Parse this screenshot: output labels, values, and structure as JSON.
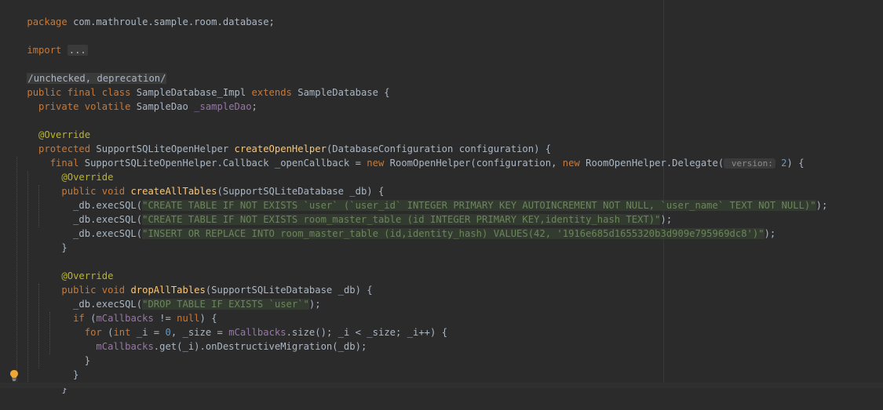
{
  "editor": {
    "lines": [
      {
        "t": "package com.mathroule.sample.room.database;"
      },
      {
        "t": ""
      },
      {
        "t": "import ..."
      },
      {
        "t": ""
      },
      {
        "t": "/unchecked, deprecation/"
      },
      {
        "t": "public final class SampleDatabase_Impl extends SampleDatabase {"
      },
      {
        "t": "  private volatile SampleDao _sampleDao;"
      },
      {
        "t": ""
      },
      {
        "t": "  @Override"
      },
      {
        "t": "  protected SupportSQLiteOpenHelper createOpenHelper(DatabaseConfiguration configuration) {"
      },
      {
        "t": "    final SupportSQLiteOpenHelper.Callback _openCallback = new RoomOpenHelper(configuration, new RoomOpenHelper.Delegate( version: 2) {"
      },
      {
        "t": "      @Override"
      },
      {
        "t": "      public void createAllTables(SupportSQLiteDatabase _db) {"
      },
      {
        "t": "        _db.execSQL(\"CREATE TABLE IF NOT EXISTS `user` (`user_id` INTEGER PRIMARY KEY AUTOINCREMENT NOT NULL, `user_name` TEXT NOT NULL)\");"
      },
      {
        "t": "        _db.execSQL(\"CREATE TABLE IF NOT EXISTS room_master_table (id INTEGER PRIMARY KEY,identity_hash TEXT)\");"
      },
      {
        "t": "        _db.execSQL(\"INSERT OR REPLACE INTO room_master_table (id,identity_hash) VALUES(42, '1916e685d1655320b3d909e795969dc8')\");"
      },
      {
        "t": "      }"
      },
      {
        "t": ""
      },
      {
        "t": "      @Override"
      },
      {
        "t": "      public void dropAllTables(SupportSQLiteDatabase _db) {"
      },
      {
        "t": "        _db.execSQL(\"DROP TABLE IF EXISTS `user`\");"
      },
      {
        "t": "        if (mCallbacks != null) {"
      },
      {
        "t": "          for (int _i = 0, _size = mCallbacks.size(); _i < _size; _i++) {"
      },
      {
        "t": "            mCallbacks.get(_i).onDestructiveMigration(_db);"
      },
      {
        "t": "          }"
      },
      {
        "t": "        }"
      },
      {
        "t": "      }"
      }
    ],
    "tokens": {
      "l0": [
        "package",
        " com.mathroule.sample.room.database;"
      ],
      "l2": [
        "import",
        " ",
        "..."
      ],
      "l4": [
        "/unchecked, deprecation/"
      ],
      "l5": [
        "public final class",
        " SampleDatabase_Impl ",
        "extends",
        " SampleDatabase {"
      ],
      "l6": [
        "  ",
        "private volatile",
        " SampleDao ",
        "_sampleDao",
        ";"
      ],
      "l8": [
        "  ",
        "@Override"
      ],
      "l9": [
        "  ",
        "protected",
        " SupportSQLiteOpenHelper ",
        "createOpenHelper",
        "(DatabaseConfiguration configuration) {"
      ],
      "l10": [
        "    ",
        "final",
        " SupportSQLiteOpenHelper.Callback _openCallback = ",
        "new",
        " RoomOpenHelper(configuration, ",
        "new",
        " RoomOpenHelper.Delegate(",
        " version:",
        " 2",
        ") {"
      ],
      "l11": [
        "      ",
        "@Override"
      ],
      "l12": [
        "      ",
        "public void",
        " ",
        "createAllTables",
        "(SupportSQLiteDatabase _db) {"
      ],
      "l13": [
        "        _db.execSQL(",
        "\"CREATE TABLE IF NOT EXISTS `user` (`user_id` INTEGER PRIMARY KEY AUTOINCREMENT NOT NULL, `user_name` TEXT NOT NULL)\"",
        ");"
      ],
      "l14": [
        "        _db.execSQL(",
        "\"CREATE TABLE IF NOT EXISTS room_master_table (id INTEGER PRIMARY KEY,identity_hash TEXT)\"",
        ");"
      ],
      "l15": [
        "        _db.execSQL(",
        "\"INSERT OR REPLACE INTO room_master_table (id,identity_hash) VALUES(42, '1916e685d1655320b3d909e795969dc8')\"",
        ");"
      ],
      "l16": [
        "      }"
      ],
      "l18": [
        "      ",
        "@Override"
      ],
      "l19": [
        "      ",
        "public void",
        " ",
        "dropAllTables",
        "(SupportSQLiteDatabase _db) {"
      ],
      "l20": [
        "        _db.execSQL(",
        "\"DROP TABLE IF EXISTS `user`\"",
        ");"
      ],
      "l21": [
        "        ",
        "if",
        " (",
        "mCallbacks",
        " != ",
        "null",
        ") {"
      ],
      "l22": [
        "          ",
        "for",
        " (",
        "int",
        " _i = ",
        "0",
        ", _size = ",
        "mCallbacks",
        ".size(); _i < _size; _i++) {"
      ],
      "l23": [
        "            ",
        "mCallbacks",
        ".get(_i).onDestructiveMigration(_db);"
      ],
      "l24": [
        "          }"
      ],
      "l25": [
        "        }"
      ],
      "l26": [
        "      }"
      ]
    }
  },
  "colors": {
    "background": "#2b2b2b",
    "keyword": "#cc7832",
    "annotation": "#bbb529",
    "method": "#ffc66d",
    "string": "#6a8759",
    "number": "#6897bb",
    "field": "#9876aa",
    "text": "#a9b7c6"
  },
  "gutter": {
    "intention_icon": "lightbulb-icon"
  }
}
